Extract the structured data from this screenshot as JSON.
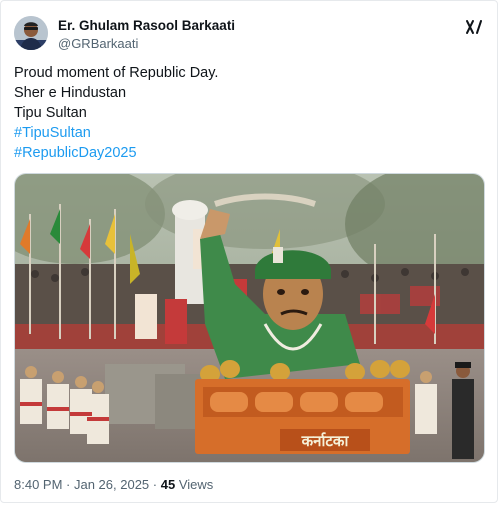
{
  "author": {
    "display_name": "Er. Ghulam Rasool Barkaati",
    "handle": "@GRBarkaati"
  },
  "tweet": {
    "lines": [
      "Proud moment of Republic Day.",
      "Sher e Hindustan",
      "Tipu Sultan"
    ],
    "hashtags": [
      "#TipuSultan",
      "#RepublicDay2025"
    ]
  },
  "media": {
    "float_caption": "कर्नाटका",
    "alt": "Republic Day parade tableau"
  },
  "meta": {
    "time": "8:40 PM",
    "separator1": " · ",
    "date": "Jan 26, 2025",
    "separator2": " · ",
    "views_count": "45",
    "views_label": " Views"
  },
  "icons": {
    "x_logo": "grok-icon",
    "avatar": "avatar"
  },
  "colors": {
    "link": "#1d9bf0",
    "secondary_text": "#536471",
    "primary_text": "#0f1419"
  }
}
